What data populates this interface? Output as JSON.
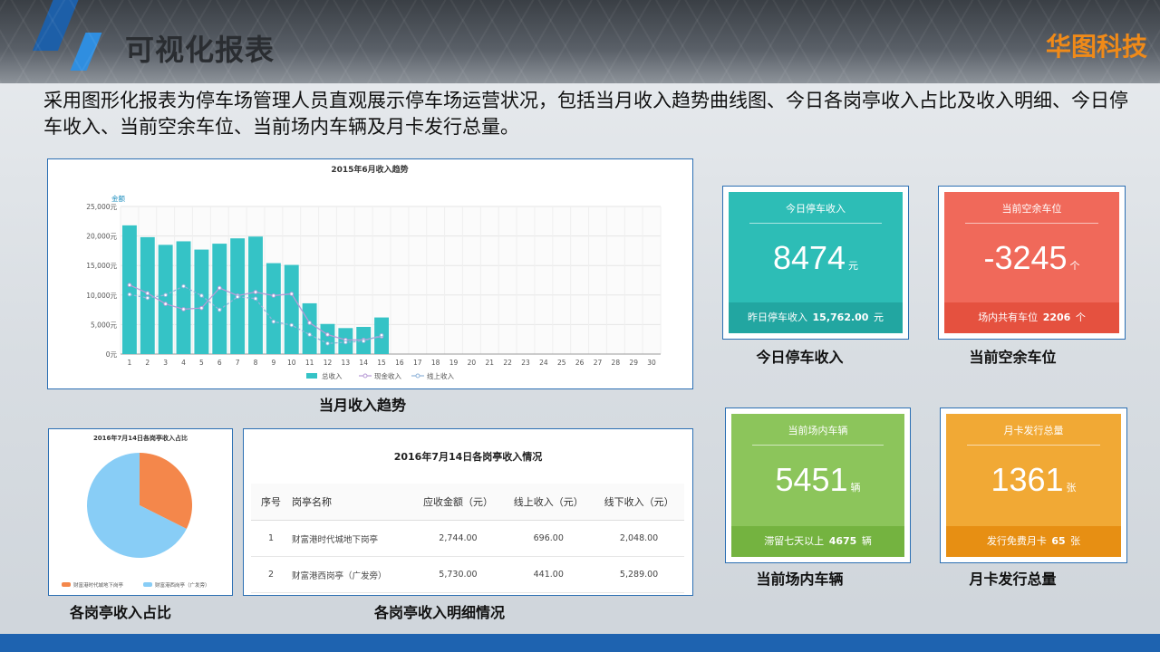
{
  "header": {
    "title": "可视化报表",
    "brand": "华图科技"
  },
  "intro": "采用图形化报表为停车场管理人员直观展示停车场运营状况，包括当月收入趋势曲线图、今日各岗亭收入占比及收入明细、今日停车收入、当前空余车位、当前场内车辆及月卡发行总量。",
  "captions": {
    "trend": "当月收入趋势",
    "pie": "各岗亭收入占比",
    "table": "各岗亭收入明细情况",
    "kpi1": "今日停车收入",
    "kpi2": "当前空余车位",
    "kpi3": "当前场内车辆",
    "kpi4": "月卡发行总量"
  },
  "chart_data": [
    {
      "type": "bar",
      "title": "2015年6月收入趋势",
      "ylabel": "金额",
      "ylim": [
        0,
        25000
      ],
      "ytick_labels": [
        "0元",
        "5,000元",
        "10,000元",
        "15,000元",
        "20,000元",
        "25,000元"
      ],
      "categories": [
        "1",
        "2",
        "3",
        "4",
        "5",
        "6",
        "7",
        "8",
        "9",
        "10",
        "11",
        "12",
        "13",
        "14",
        "15",
        "16",
        "17",
        "18",
        "19",
        "20",
        "21",
        "22",
        "23",
        "24",
        "25",
        "26",
        "27",
        "28",
        "29",
        "30"
      ],
      "series": [
        {
          "name": "总收入",
          "type": "bar",
          "color": "#35c3c6",
          "values": [
            21800,
            19800,
            18500,
            19100,
            17700,
            18700,
            19600,
            19900,
            15400,
            15100,
            8600,
            5100,
            4400,
            4600,
            6200,
            null,
            null,
            null,
            null,
            null,
            null,
            null,
            null,
            null,
            null,
            null,
            null,
            null,
            null,
            null
          ]
        },
        {
          "name": "现金收入",
          "type": "line",
          "color": "#b79ad6",
          "values": [
            11700,
            10300,
            8500,
            7600,
            7800,
            11200,
            9900,
            10500,
            9900,
            10200,
            5300,
            3300,
            2400,
            2400,
            3000,
            null,
            null,
            null,
            null,
            null,
            null,
            null,
            null,
            null,
            null,
            null,
            null,
            null,
            null,
            null
          ]
        },
        {
          "name": "线上收入",
          "type": "line",
          "color": "#8fb3d9",
          "values": [
            10100,
            9500,
            10000,
            11500,
            9900,
            7500,
            9700,
            9400,
            5500,
            4900,
            3300,
            1800,
            2000,
            2200,
            3200,
            null,
            null,
            null,
            null,
            null,
            null,
            null,
            null,
            null,
            null,
            null,
            null,
            null,
            null,
            null
          ]
        }
      ],
      "legend": "bottom"
    },
    {
      "type": "pie",
      "title": "2016年7月14日各岗亭收入占比",
      "labels": [
        "财富港时代城地下岗亭",
        "财富港西岗亭（广发旁）"
      ],
      "values": [
        2744.0,
        5730.0
      ],
      "colors": [
        "#f4874b",
        "#88cdf6"
      ],
      "legend": "bottom"
    }
  ],
  "table": {
    "title": "2016年7月14日各岗亭收入情况",
    "columns": [
      "序号",
      "岗亭名称",
      "应收金额（元）",
      "线上收入（元）",
      "线下收入（元）"
    ],
    "rows": [
      [
        "1",
        "财富港时代城地下岗亭",
        "2,744.00",
        "696.00",
        "2,048.00"
      ],
      [
        "2",
        "财富港西岗亭（广发旁）",
        "5,730.00",
        "441.00",
        "5,289.00"
      ]
    ]
  },
  "kpis": {
    "income": {
      "title": "今日停车收入",
      "value": "8474",
      "unit": "元",
      "foot_label": "昨日停车收入",
      "foot_value": "15,762.00",
      "foot_unit": "元",
      "color": "#2dbdb6",
      "foot_color": "#22a6a1"
    },
    "spaces": {
      "title": "当前空余车位",
      "value": "-3245",
      "unit": "个",
      "foot_label": "场内共有车位",
      "foot_value": "2206",
      "foot_unit": "个",
      "color": "#f0695a",
      "foot_color": "#e5513f"
    },
    "vehicles": {
      "title": "当前场内车辆",
      "value": "5451",
      "unit": "辆",
      "foot_label": "滞留七天以上",
      "foot_value": "4675",
      "foot_unit": "辆",
      "color": "#8cc55b",
      "foot_color": "#74b340"
    },
    "cards": {
      "title": "月卡发行总量",
      "value": "1361",
      "unit": "张",
      "foot_label": "发行免费月卡",
      "foot_value": "65",
      "foot_unit": "张",
      "color": "#f1a935",
      "foot_color": "#e78f13"
    }
  }
}
